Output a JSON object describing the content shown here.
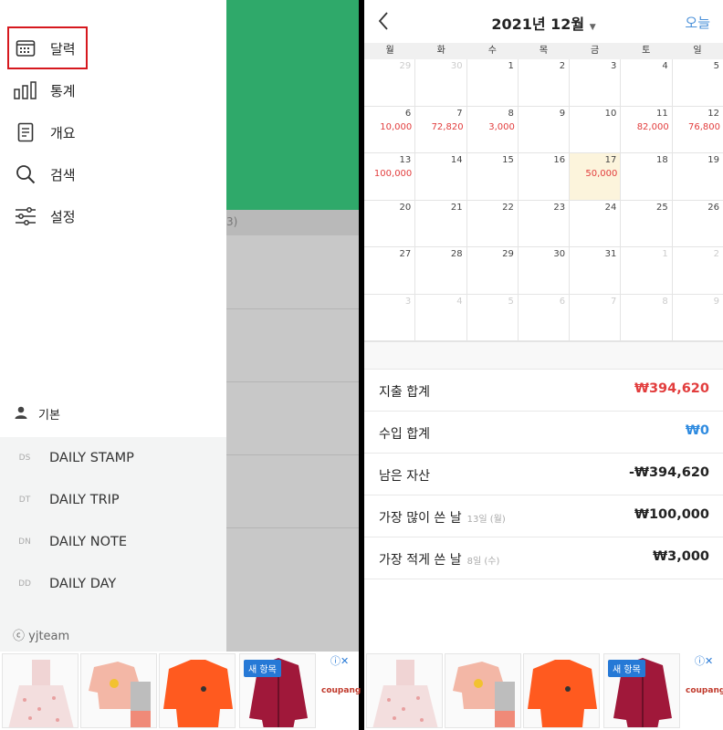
{
  "drawer": {
    "menu": [
      {
        "label": "달력",
        "icon": "calendar-icon"
      },
      {
        "label": "통계",
        "icon": "bar-chart-icon"
      },
      {
        "label": "개요",
        "icon": "document-icon"
      },
      {
        "label": "검색",
        "icon": "search-icon"
      },
      {
        "label": "설정",
        "icon": "sliders-icon"
      }
    ],
    "account_label": "기본",
    "apps": [
      {
        "code": "DS",
        "name": "DAILY STAMP"
      },
      {
        "code": "DT",
        "name": "DAILY TRIP"
      },
      {
        "code": "DN",
        "name": "DAILY NOTE"
      },
      {
        "code": "DD",
        "name": "DAILY DAY"
      }
    ],
    "copyright": "ⓒ yjteam",
    "background_strip_text": "3)"
  },
  "ad": {
    "badge": "새 항목",
    "brand": "coupang",
    "info_icon": "ⓘ✕"
  },
  "calendar": {
    "title": "2021년 12월",
    "today_button": "오늘",
    "weekdays": [
      "월",
      "화",
      "수",
      "목",
      "금",
      "토",
      "일"
    ],
    "weeks": [
      [
        {
          "d": "29",
          "m": true
        },
        {
          "d": "30",
          "m": true
        },
        {
          "d": "1"
        },
        {
          "d": "2"
        },
        {
          "d": "3"
        },
        {
          "d": "4"
        },
        {
          "d": "5"
        }
      ],
      [
        {
          "d": "6",
          "a": "10,000"
        },
        {
          "d": "7",
          "a": "72,820"
        },
        {
          "d": "8",
          "a": "3,000"
        },
        {
          "d": "9"
        },
        {
          "d": "10"
        },
        {
          "d": "11",
          "a": "82,000"
        },
        {
          "d": "12",
          "a": "76,800"
        }
      ],
      [
        {
          "d": "13",
          "a": "100,000"
        },
        {
          "d": "14"
        },
        {
          "d": "15"
        },
        {
          "d": "16"
        },
        {
          "d": "17",
          "a": "50,000",
          "t": true
        },
        {
          "d": "18"
        },
        {
          "d": "19"
        }
      ],
      [
        {
          "d": "20"
        },
        {
          "d": "21"
        },
        {
          "d": "22"
        },
        {
          "d": "23"
        },
        {
          "d": "24"
        },
        {
          "d": "25"
        },
        {
          "d": "26"
        }
      ],
      [
        {
          "d": "27"
        },
        {
          "d": "28"
        },
        {
          "d": "29"
        },
        {
          "d": "30"
        },
        {
          "d": "31"
        },
        {
          "d": "1",
          "m": true
        },
        {
          "d": "2",
          "m": true
        }
      ],
      [
        {
          "d": "3",
          "m": true
        },
        {
          "d": "4",
          "m": true
        },
        {
          "d": "5",
          "m": true
        },
        {
          "d": "6",
          "m": true
        },
        {
          "d": "7",
          "m": true
        },
        {
          "d": "8",
          "m": true
        },
        {
          "d": "9",
          "m": true
        }
      ]
    ]
  },
  "summary": {
    "expense_label": "지출 합계",
    "expense_value": "₩394,620",
    "income_label": "수입 합계",
    "income_value": "₩0",
    "balance_label": "남은 자산",
    "balance_value": "-₩394,620",
    "max_label": "가장 많이 쓴 날",
    "max_sub": "13일 (월)",
    "max_value": "₩100,000",
    "min_label": "가장 적게 쓴 날",
    "min_sub": "8일 (수)",
    "min_value": "₩3,000"
  },
  "colors": {
    "accent_green": "#2fa96a",
    "expense_red": "#e23d3d",
    "income_blue": "#2f8be0",
    "highlight_red": "#d6181e"
  }
}
